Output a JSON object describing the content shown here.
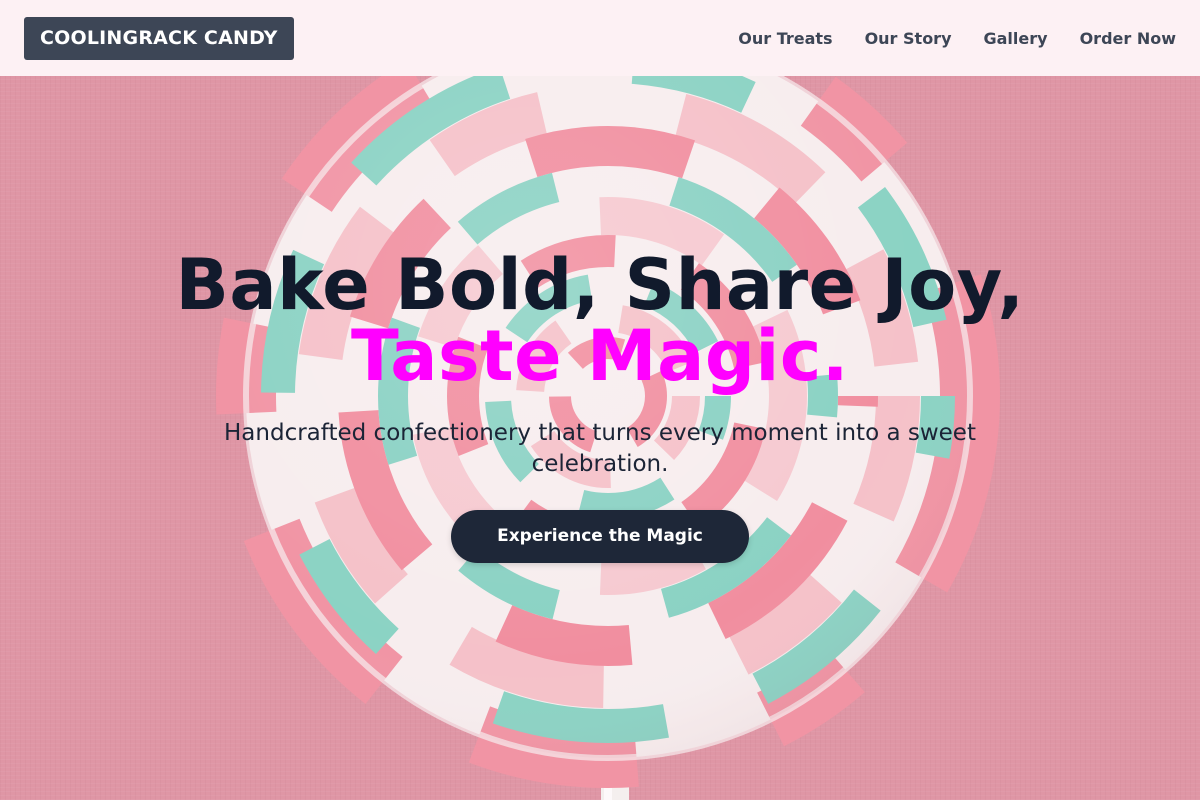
{
  "header": {
    "brand": "COOLINGRACK CANDY",
    "nav": [
      {
        "label": "Our Treats"
      },
      {
        "label": "Our Story"
      },
      {
        "label": "Gallery"
      },
      {
        "label": "Order Now"
      }
    ]
  },
  "hero": {
    "title_line1": "Bake Bold, Share Joy,",
    "title_line2": "Taste Magic.",
    "subtitle": "Handcrafted confectionery that turns every moment into a sweet celebration.",
    "cta_label": "Experience the Magic"
  },
  "colors": {
    "header_bg": "#fdf1f4",
    "brand_bg": "#3d4656",
    "title_text": "#111a2c",
    "accent_magenta": "#ff00ff",
    "cta_bg": "#1e2738",
    "background_pink": "#d98697",
    "candy_pink": "#ef7d90",
    "candy_mint": "#74cdbb",
    "candy_white": "#f4f1ef"
  }
}
